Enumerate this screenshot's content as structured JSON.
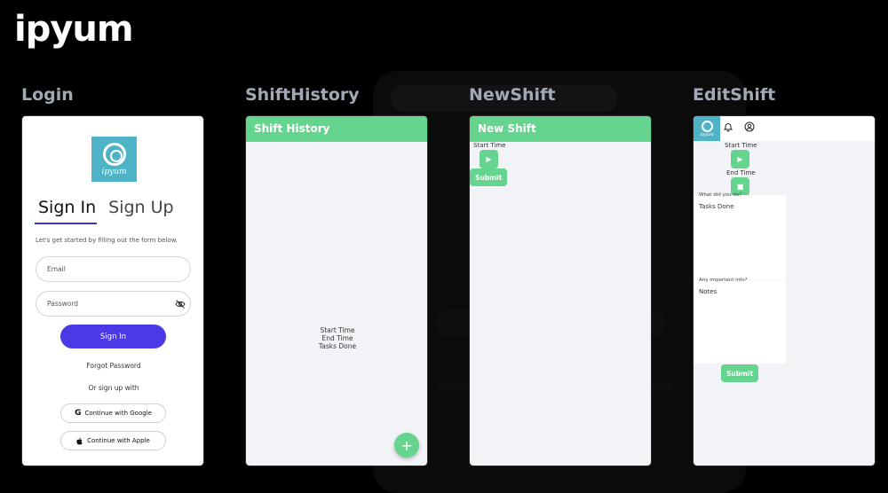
{
  "brand": "ipyum",
  "screens": {
    "login": {
      "label": "Login",
      "logo_text": "ipyum",
      "tab_signin": "Sign In",
      "tab_signup": "Sign Up",
      "intro": "Let's get started by filling out the form below.",
      "email_placeholder": "Email",
      "password_placeholder": "Password",
      "signin_button": "Sign In",
      "forgot_password": "Forgot Password",
      "or_signup": "Or sign up with",
      "google_button": "Continue with Google",
      "apple_button": "Continue with Apple"
    },
    "history": {
      "label": "ShiftHistory",
      "header": "Shift History",
      "start_time": "Start Time",
      "end_time": "End  Time",
      "tasks_done": "Tasks Done",
      "fab": "+"
    },
    "newshift": {
      "label": "NewShift",
      "header": "New Shift",
      "start_time": "Start Time",
      "submit": "Submit"
    },
    "editshift": {
      "label": "EditShift",
      "logo_text": "ipyum",
      "start_time": "Start Time",
      "end_time": "End Time",
      "what_label": "What did you do?",
      "tasks_done": "Tasks Done",
      "info_label": "Any important info?",
      "notes": "Notes",
      "submit": "Submit"
    }
  },
  "colors": {
    "accent_green": "#65d48f",
    "primary_purple": "#4b39e6",
    "logo_teal": "#4fb3c8"
  }
}
